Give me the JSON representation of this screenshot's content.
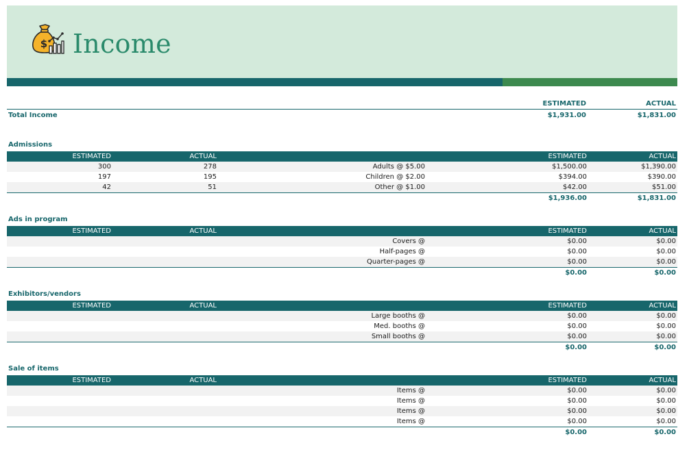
{
  "header": {
    "title": "Income",
    "icon": "money-bag-chart-icon",
    "colors": {
      "band": "#d3eadb",
      "title": "#2a8a6b",
      "accent_teal": "#17666b",
      "accent_green": "#3d8a4f"
    }
  },
  "summary": {
    "estimated_header": "ESTIMATED",
    "actual_header": "ACTUAL",
    "label": "Total Income",
    "estimated": "$1,931.00",
    "actual": "$1,831.00"
  },
  "sections": {
    "admissions": {
      "title": "Admissions",
      "headers": {
        "estimated": "ESTIMATED",
        "actual": "ACTUAL",
        "estimated2": "ESTIMATED",
        "actual2": "ACTUAL"
      },
      "rows": [
        {
          "est_qty": "300",
          "act_qty": "278",
          "label": "Adults @ $5.00",
          "estimated": "$1,500.00",
          "actual": "$1,390.00"
        },
        {
          "est_qty": "197",
          "act_qty": "195",
          "label": "Children @ $2.00",
          "estimated": "$394.00",
          "actual": "$390.00"
        },
        {
          "est_qty": "42",
          "act_qty": "51",
          "label": "Other @ $1.00",
          "estimated": "$42.00",
          "actual": "$51.00"
        }
      ],
      "total": {
        "estimated": "$1,936.00",
        "actual": "$1,831.00"
      }
    },
    "ads": {
      "title": "Ads in program",
      "headers": {
        "estimated": "ESTIMATED",
        "actual": "ACTUAL",
        "estimated2": "ESTIMATED",
        "actual2": "ACTUAL"
      },
      "rows": [
        {
          "est_qty": "",
          "act_qty": "",
          "label": "Covers @",
          "estimated": "$0.00",
          "actual": "$0.00"
        },
        {
          "est_qty": "",
          "act_qty": "",
          "label": "Half-pages @",
          "estimated": "$0.00",
          "actual": "$0.00"
        },
        {
          "est_qty": "",
          "act_qty": "",
          "label": "Quarter-pages @",
          "estimated": "$0.00",
          "actual": "$0.00"
        }
      ],
      "total": {
        "estimated": "$0.00",
        "actual": "$0.00"
      }
    },
    "exhibitors": {
      "title": "Exhibitors/vendors",
      "headers": {
        "estimated": "ESTIMATED",
        "actual": "ACTUAL",
        "estimated2": "ESTIMATED",
        "actual2": "ACTUAL"
      },
      "rows": [
        {
          "est_qty": "",
          "act_qty": "",
          "label": "Large booths @",
          "estimated": "$0.00",
          "actual": "$0.00"
        },
        {
          "est_qty": "",
          "act_qty": "",
          "label": "Med. booths @",
          "estimated": "$0.00",
          "actual": "$0.00"
        },
        {
          "est_qty": "",
          "act_qty": "",
          "label": "Small booths @",
          "estimated": "$0.00",
          "actual": "$0.00"
        }
      ],
      "total": {
        "estimated": "$0.00",
        "actual": "$0.00"
      }
    },
    "sale": {
      "title": "Sale of items",
      "headers": {
        "estimated": "ESTIMATED",
        "actual": "ACTUAL",
        "estimated2": "ESTIMATED",
        "actual2": "ACTUAL"
      },
      "rows": [
        {
          "est_qty": "",
          "act_qty": "",
          "label": "Items @",
          "estimated": "$0.00",
          "actual": "$0.00"
        },
        {
          "est_qty": "",
          "act_qty": "",
          "label": "Items @",
          "estimated": "$0.00",
          "actual": "$0.00"
        },
        {
          "est_qty": "",
          "act_qty": "",
          "label": "Items @",
          "estimated": "$0.00",
          "actual": "$0.00"
        },
        {
          "est_qty": "",
          "act_qty": "",
          "label": "Items @",
          "estimated": "$0.00",
          "actual": "$0.00"
        }
      ],
      "total": {
        "estimated": "$0.00",
        "actual": "$0.00"
      }
    }
  }
}
